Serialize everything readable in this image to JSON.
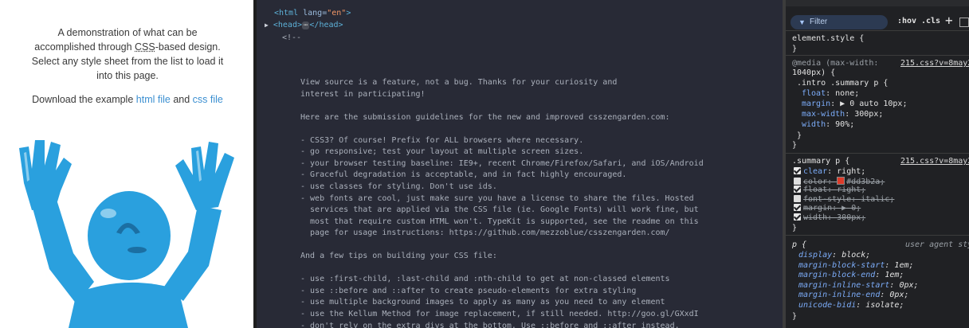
{
  "preview": {
    "summary_line1": "A demonstration of what can be",
    "summary_line2_pre": "accomplished through ",
    "summary_line2_abbr": "CSS",
    "summary_line2_post": "-based design.",
    "summary_line3": "Select any style sheet from the list to load it",
    "summary_line4": "into this page.",
    "download_pre": "Download the example ",
    "html_link": "html file",
    "download_mid": " and ",
    "css_link": "css file",
    "robot_color": "#2aa0de"
  },
  "source": {
    "line1_tag_open": "<html ",
    "line1_attr": "lang=",
    "line1_val": "\"en\"",
    "line1_tag_close": ">",
    "line2_open": "<head>",
    "line2_ellipsis": "⋯",
    "line2_close": "</head>",
    "comment_open": "<!--",
    "lines": [
      "View source is a feature, not a bug. Thanks for your curiosity and",
      "interest in participating!",
      "",
      "Here are the submission guidelines for the new and improved csszengarden.com:",
      "",
      "- CSS3? Of course! Prefix for ALL browsers where necessary.",
      "- go responsive; test your layout at multiple screen sizes.",
      "- your browser testing baseline: IE9+, recent Chrome/Firefox/Safari, and iOS/Android",
      "- Graceful degradation is acceptable, and in fact highly encouraged.",
      "- use classes for styling. Don't use ids.",
      "- web fonts are cool, just make sure you have a license to share the files. Hosted",
      "  services that are applied via the CSS file (ie. Google Fonts) will work fine, but",
      "  most that require custom HTML won't. TypeKit is supported, see the readme on this",
      "  page for usage instructions: https://github.com/mezzoblue/csszengarden.com/",
      "",
      "And a few tips on building your CSS file:",
      "",
      "- use :first-child, :last-child and :nth-child to get at non-classed elements",
      "- use ::before and ::after to create pseudo-elements for extra styling",
      "- use multiple background images to apply as many as you need to any element",
      "- use the Kellum Method for image replacement, if still needed. http://goo.gl/GXxdI",
      "- don't rely on the extra divs at the bottom. Use ::before and ::after instead."
    ]
  },
  "styles": {
    "filter_placeholder": "Filter",
    "hov_label": ":hov",
    "cls_label": ".cls",
    "plus_label": "+",
    "element_style_selector": "element.style {",
    "close_brace": "}",
    "media_line1": "@media (max-width:",
    "media_line2": "1040px) {",
    "media_source": "215.css?v=8may2",
    "media_selector": ".intro .summary p {",
    "media_props": [
      {
        "name": "float",
        "value": "none;"
      },
      {
        "name": "margin",
        "value": "▶ 0 auto 10px;"
      },
      {
        "name": "max-width",
        "value": "300px;"
      },
      {
        "name": "width",
        "value": "90%;"
      }
    ],
    "summary_selector": ".summary p {",
    "summary_source": "215.css?v=8may2",
    "summary_props": [
      {
        "name": "clear",
        "value": "right;",
        "checked": true,
        "struck": false
      },
      {
        "name": "color",
        "value": "#dd3b2a;",
        "checked": false,
        "struck": true,
        "swatch": "#dd3b2a"
      },
      {
        "name": "float",
        "value": "right;",
        "checked": true,
        "struck": true
      },
      {
        "name": "font-style",
        "value": "italic;",
        "checked": false,
        "struck": true
      },
      {
        "name": "margin",
        "value": "▶ 0;",
        "checked": true,
        "struck": true
      },
      {
        "name": "width",
        "value": "300px;",
        "checked": true,
        "struck": true
      }
    ],
    "ua_selector": "p {",
    "ua_label": "user agent sty",
    "ua_props": [
      {
        "name": "display",
        "value": "block;"
      },
      {
        "name": "margin-block-start",
        "value": "1em;"
      },
      {
        "name": "margin-block-end",
        "value": "1em;"
      },
      {
        "name": "margin-inline-start",
        "value": "0px;"
      },
      {
        "name": "margin-inline-end",
        "value": "0px;"
      },
      {
        "name": "unicode-bidi",
        "value": "isolate;"
      }
    ]
  }
}
